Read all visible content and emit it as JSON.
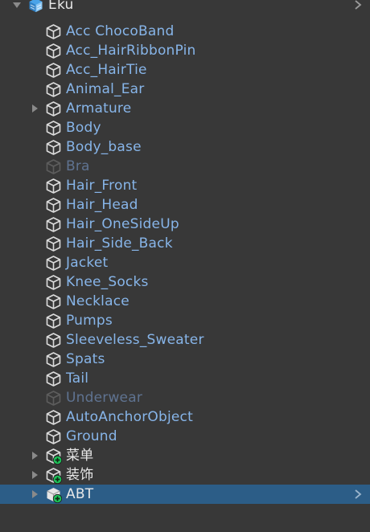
{
  "root": {
    "label": "Eku",
    "expanded": true
  },
  "children": [
    {
      "label": "Acc ChocoBand",
      "type": "prefab"
    },
    {
      "label": "Acc_HairRibbonPin",
      "type": "prefab"
    },
    {
      "label": "Acc_HairTie",
      "type": "prefab"
    },
    {
      "label": "Animal_Ear",
      "type": "prefab"
    },
    {
      "label": "Armature",
      "type": "prefab",
      "expandable": true
    },
    {
      "label": "Body",
      "type": "prefab"
    },
    {
      "label": "Body_base",
      "type": "prefab"
    },
    {
      "label": "Bra",
      "type": "prefab",
      "disabled": true
    },
    {
      "label": "Hair_Front",
      "type": "prefab"
    },
    {
      "label": "Hair_Head",
      "type": "prefab"
    },
    {
      "label": "Hair_OneSideUp",
      "type": "prefab"
    },
    {
      "label": "Hair_Side_Back",
      "type": "prefab"
    },
    {
      "label": "Jacket",
      "type": "prefab"
    },
    {
      "label": "Knee_Socks",
      "type": "prefab"
    },
    {
      "label": "Necklace",
      "type": "prefab"
    },
    {
      "label": "Pumps",
      "type": "prefab"
    },
    {
      "label": "Sleeveless_Sweater",
      "type": "prefab"
    },
    {
      "label": "Spats",
      "type": "prefab"
    },
    {
      "label": "Tail",
      "type": "prefab"
    },
    {
      "label": "Underwear",
      "type": "prefab",
      "disabled": true
    },
    {
      "label": "AutoAnchorObject",
      "type": "prefab"
    },
    {
      "label": "Ground",
      "type": "prefab"
    },
    {
      "label": "菜单",
      "type": "added",
      "expandable": true
    },
    {
      "label": "装饰",
      "type": "added",
      "expandable": true
    },
    {
      "label": "ABT",
      "type": "added-selected",
      "expandable": true,
      "selected": true
    }
  ],
  "colors": {
    "background": "#383838",
    "selection": "#2c5d87",
    "prefab_text": "#87b5e9",
    "disabled_text": "#5f7391",
    "plain_text": "#e8e8e8",
    "added_badge": "#1ec45a"
  }
}
